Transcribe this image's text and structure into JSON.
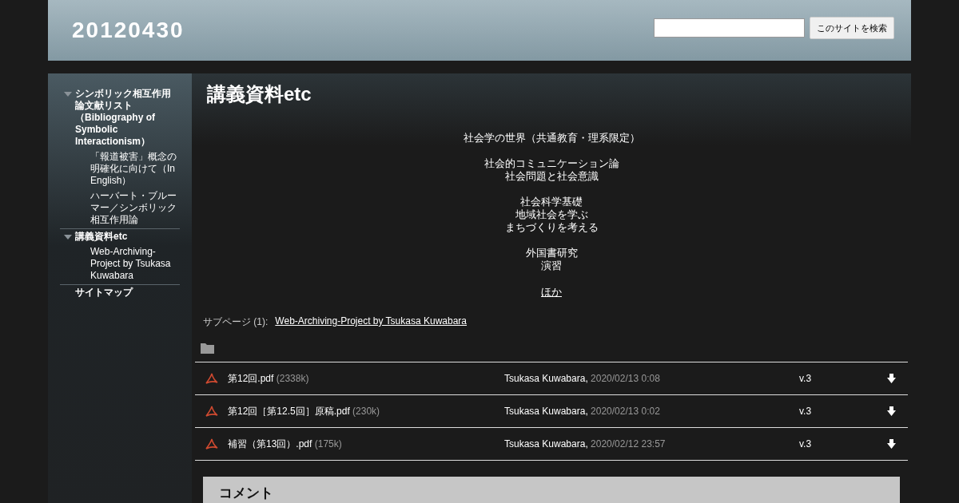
{
  "site_title": "20120430",
  "search": {
    "button": "このサイトを検索"
  },
  "sidebar": {
    "items": [
      {
        "label": "シンボリック相互作用論文献リスト（Bibliography of Symbolic Interactionism）",
        "expanded": true,
        "children": [
          {
            "label": "「報道被害」概念の明確化に向けて（In English）"
          },
          {
            "label": "ハーバート・ブルーマー／シンボリック相互作用論"
          }
        ]
      },
      {
        "label": "講義資料etc",
        "expanded": true,
        "children": [
          {
            "label": "Web-Archiving-Project by Tsukasa Kuwabara"
          }
        ]
      },
      {
        "label": "サイトマップ",
        "expanded": false
      }
    ]
  },
  "page_title": "講義資料etc",
  "body_groups": [
    [
      "社会学の世界（共通教育・理系限定）"
    ],
    [
      "社会的コミュニケーション論",
      "社会問題と社会意識"
    ],
    [
      "社会科学基礎",
      "地域社会を学ぶ",
      "まちづくりを考える"
    ],
    [
      "外国書研究",
      "演習"
    ]
  ],
  "more_link": "ほか",
  "subpages": {
    "label": "サブページ (1):",
    "link": "Web-Archiving-Project by Tsukasa Kuwabara"
  },
  "files": [
    {
      "name": "第12回.pdf",
      "size": "(2338k)",
      "author": "Tsukasa Kuwabara,",
      "date": "2020/02/13 0:08",
      "version": "v.3"
    },
    {
      "name": "第12回［第12.5回］原稿.pdf",
      "size": "(230k)",
      "author": "Tsukasa Kuwabara,",
      "date": "2020/02/13 0:02",
      "version": "v.3"
    },
    {
      "name": "補習（第13回）.pdf",
      "size": "(175k)",
      "author": "Tsukasa Kuwabara,",
      "date": "2020/02/12 23:57",
      "version": "v.3"
    }
  ],
  "comments": {
    "title": "コメント"
  }
}
